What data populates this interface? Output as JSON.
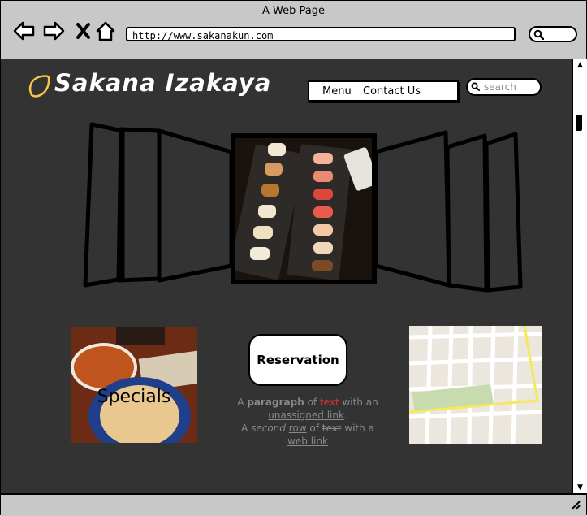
{
  "window": {
    "title": "A Web Page"
  },
  "browser": {
    "url": "http://www.sakanakun.com",
    "icons": [
      "back-arrow-icon",
      "forward-arrow-icon",
      "close-x-icon",
      "home-icon",
      "search-icon"
    ]
  },
  "site": {
    "brand": "Sakana Izakaya",
    "menu": {
      "menu_label": "Menu",
      "contact_label": "Contact Us"
    },
    "search": {
      "placeholder": "search"
    }
  },
  "cards": {
    "specials_label": "Specials",
    "reservation_label": "Reservation"
  },
  "paragraph": {
    "line1": {
      "a": "A ",
      "bold": "paragraph",
      "of": " of ",
      "red": "text",
      "with": " with an"
    },
    "link1": "unassigned link",
    "period": ".",
    "line2": {
      "a": "A ",
      "italic": "second",
      "sp": " ",
      "row": "row",
      "of": " of ",
      "strike": "text",
      "with": " with a"
    },
    "link2": "web link"
  },
  "colors": {
    "page_bg": "#333333",
    "chrome": "#c8c8c8",
    "accent_red": "#e0302a",
    "logo_yellow": "#f2c744",
    "map_highlight": "#f5e85a"
  }
}
